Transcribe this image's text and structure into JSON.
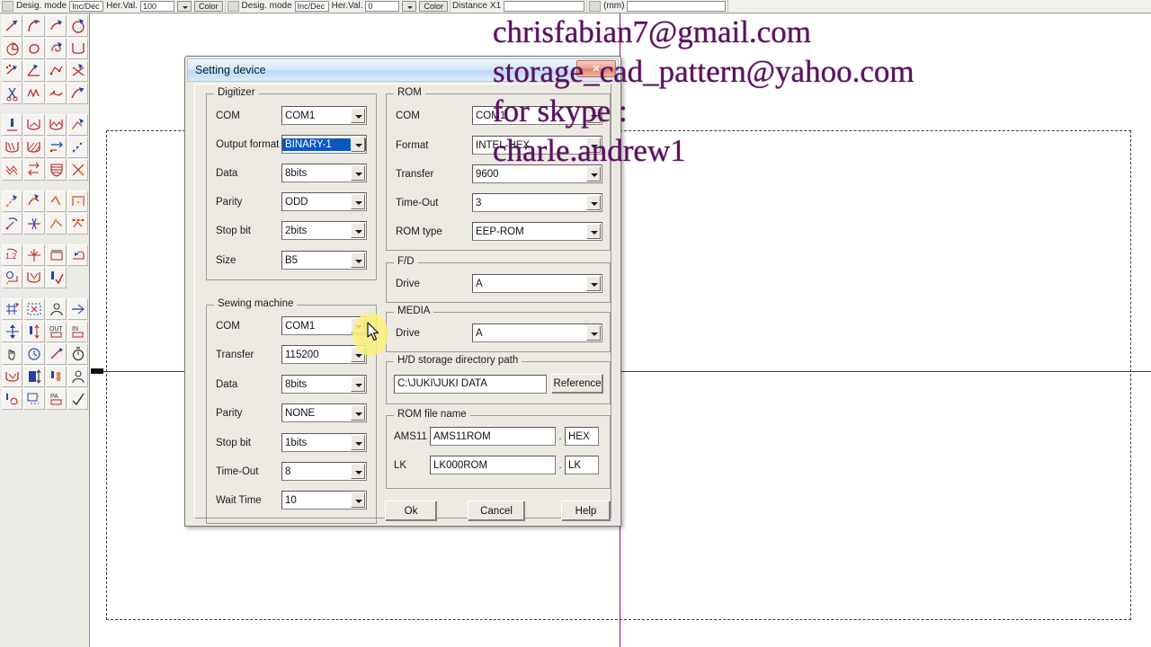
{
  "app": {
    "toolbar": {
      "groups": [
        {
          "icon": "design-mode-icon",
          "label": "Desig. mode",
          "field": "Inc/Dec",
          "label2": "Her.Val.",
          "value": "100",
          "button": "Color"
        },
        {
          "icon": "design-mode-red-icon",
          "label": "Desig. mode",
          "field": "Inc/Dec",
          "label2": "Her.Val.",
          "value": "0",
          "button": "Color"
        },
        {
          "icon": "distance-icon",
          "label": "Distance",
          "field": "X1",
          "label2": "",
          "value": "",
          "button": ""
        },
        {
          "icon": "ruler-icon",
          "label": "(mm)",
          "field": "",
          "label2": "",
          "value": "",
          "button": ""
        }
      ]
    }
  },
  "watermark": {
    "lines": [
      "chrisfabian7@gmail.com",
      "storage_cad_pattern@yahoo.com",
      "for skype :",
      "charle.andrew1"
    ]
  },
  "dialog": {
    "title": "Setting device",
    "close_label": "✕",
    "groups": {
      "digitizer": {
        "label": "Digitizer",
        "fields": [
          {
            "label": "COM",
            "value": "COM1",
            "type": "combo",
            "selected": false
          },
          {
            "label": "Output format",
            "value": "BINARY-1",
            "type": "combo",
            "selected": true
          },
          {
            "label": "Data",
            "value": "8bits",
            "type": "combo",
            "selected": false
          },
          {
            "label": "Parity",
            "value": "ODD",
            "type": "combo",
            "selected": false
          },
          {
            "label": "Stop bit",
            "value": "2bits",
            "type": "combo",
            "selected": false
          },
          {
            "label": "Size",
            "value": "B5",
            "type": "combo",
            "selected": false
          }
        ]
      },
      "sewing_machine": {
        "label": "Sewing machine",
        "fields": [
          {
            "label": "COM",
            "value": "COM1",
            "type": "combo"
          },
          {
            "label": "Transfer",
            "value": "115200",
            "type": "combo"
          },
          {
            "label": "Data",
            "value": "8bits",
            "type": "combo"
          },
          {
            "label": "Parity",
            "value": "NONE",
            "type": "combo"
          },
          {
            "label": "Stop bit",
            "value": "1bits",
            "type": "combo"
          },
          {
            "label": "Time-Out",
            "value": "8",
            "type": "combo"
          },
          {
            "label": "Wait Time",
            "value": "10",
            "type": "combo"
          }
        ]
      },
      "rom": {
        "label": "ROM",
        "fields": [
          {
            "label": "COM",
            "value": "COM1",
            "type": "combo"
          },
          {
            "label": "Format",
            "value": "INTEL-HEX",
            "type": "combo"
          },
          {
            "label": "Transfer",
            "value": "9600",
            "type": "combo"
          },
          {
            "label": "Time-Out",
            "value": "3",
            "type": "combo"
          },
          {
            "label": "ROM type",
            "value": "EEP-ROM",
            "type": "combo"
          }
        ]
      },
      "fd": {
        "label": "F/D",
        "fields": [
          {
            "label": "Drive",
            "value": "A",
            "type": "combo"
          }
        ]
      },
      "media": {
        "label": "MEDIA",
        "fields": [
          {
            "label": "Drive",
            "value": "A",
            "type": "combo"
          }
        ]
      },
      "hd_path": {
        "label": "H/D storage directory path",
        "path_value": "C:\\JUKI\\JUKI DATA",
        "reference_button": "Reference"
      },
      "rom_file_name": {
        "label": "ROM file name",
        "rows": [
          {
            "label": "AMS11",
            "name": "AMS11ROM",
            "sep": ".",
            "ext": "HEX"
          },
          {
            "label": "LK",
            "name": "LK000ROM",
            "sep": ".",
            "ext": "LK"
          }
        ]
      }
    },
    "buttons": {
      "ok": "Ok",
      "cancel": "Cancel",
      "help": "Help"
    }
  },
  "colors": {
    "dialog_face": "#ece9e3",
    "title_blue": "#bcd9f5",
    "selection_blue": "#0a57c2",
    "watermark_purple": "#5b1160",
    "crosshair_magenta": "#a0009a",
    "highlight_yellow": "#fcf07a"
  }
}
